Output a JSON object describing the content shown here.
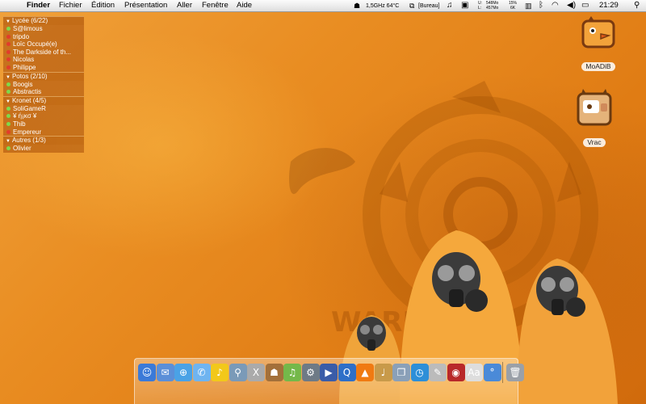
{
  "menubar": {
    "app": "Finder",
    "menus": [
      "Fichier",
      "Édition",
      "Présentation",
      "Aller",
      "Fenêtre",
      "Aide"
    ],
    "cpu": "1,5GHz 64°C",
    "display": "[Bureau]",
    "mem_used_label": "U:",
    "mem_used": "548Mo",
    "mem_free_label": "L:",
    "mem_free": "457Mo",
    "cpu_pct_a": "15%",
    "cpu_pct_b": "6K",
    "clock": "21:29"
  },
  "buddy_groups": [
    {
      "title": "Lycée (6/22)",
      "buddies": [
        {
          "name": "S@limous",
          "status": "online"
        },
        {
          "name": "tripdo",
          "status": "away"
        },
        {
          "name": "Loïc Occupé(e)",
          "status": "away"
        },
        {
          "name": "The Darkside of th...",
          "status": "away"
        },
        {
          "name": "Nicolas",
          "status": "away"
        },
        {
          "name": "Philippe",
          "status": "away"
        }
      ]
    },
    {
      "title": "Potos (2/10)",
      "buddies": [
        {
          "name": "Boogis",
          "status": "online"
        },
        {
          "name": "Abstractis",
          "status": "online"
        }
      ]
    },
    {
      "title": "Kronet (4/5)",
      "buddies": [
        {
          "name": "SoliGameR",
          "status": "online"
        },
        {
          "name": "¥ ή¡κσ ¥",
          "status": "online"
        },
        {
          "name": "Thib",
          "status": "online"
        },
        {
          "name": "Empereur",
          "status": "away"
        }
      ]
    },
    {
      "title": "Autres (1/3)",
      "buddies": [
        {
          "name": "Olivier",
          "status": "online"
        }
      ]
    }
  ],
  "desktop_icons": [
    {
      "label": "MoADiB",
      "icon": "cartoon-chick-icon"
    },
    {
      "label": "Vrac",
      "icon": "cartoon-cow-icon"
    }
  ],
  "wallpaper_text": "WARNING",
  "colors": {
    "online": "#7fd94a",
    "away": "#e23c2c",
    "accent": "#e98d22"
  },
  "dock": {
    "items": [
      {
        "name": "finder-icon",
        "color": "#3b7ad8",
        "glyph": "☺"
      },
      {
        "name": "mail-icon",
        "color": "#5b8fd8",
        "glyph": "✉"
      },
      {
        "name": "safari-icon",
        "color": "#4aa2e6",
        "glyph": "⊕"
      },
      {
        "name": "ichat-icon",
        "color": "#6fb4f0",
        "glyph": "✆"
      },
      {
        "name": "adium-duck-icon",
        "color": "#f2c81a",
        "glyph": "♪"
      },
      {
        "name": "sherlock-icon",
        "color": "#7a9ab8",
        "glyph": "⚲"
      },
      {
        "name": "x11-icon",
        "color": "#aaaaaa",
        "glyph": "X"
      },
      {
        "name": "transmission-icon",
        "color": "#a3703a",
        "glyph": "☗"
      },
      {
        "name": "itunes-icon",
        "color": "#74b84a",
        "glyph": "♫"
      },
      {
        "name": "system-preferences-icon",
        "color": "#6e7a86",
        "glyph": "⚙"
      },
      {
        "name": "imovie-icon",
        "color": "#3a5ca8",
        "glyph": "▶"
      },
      {
        "name": "quicktime-icon",
        "color": "#2e6fc8",
        "glyph": "Q"
      },
      {
        "name": "vlc-icon",
        "color": "#f07a12",
        "glyph": "▲"
      },
      {
        "name": "garageband-icon",
        "color": "#c89a4a",
        "glyph": "♩"
      },
      {
        "name": "iphoto-icon",
        "color": "#8aa0b8",
        "glyph": "❐"
      },
      {
        "name": "ical-icon",
        "color": "#2d8fd8",
        "glyph": "◷"
      },
      {
        "name": "textedit-icon",
        "color": "#bbbbbb",
        "glyph": "✎"
      },
      {
        "name": "photobooth-icon",
        "color": "#b8282a",
        "glyph": "◉"
      },
      {
        "name": "dictionary-icon",
        "color": "#dddddd",
        "glyph": "Aa"
      },
      {
        "name": "temperature-monitor-icon",
        "color": "#4a8ad8",
        "glyph": "°"
      },
      {
        "name": "trash-icon",
        "color": "#9aa0a8",
        "glyph": "🗑"
      }
    ]
  }
}
